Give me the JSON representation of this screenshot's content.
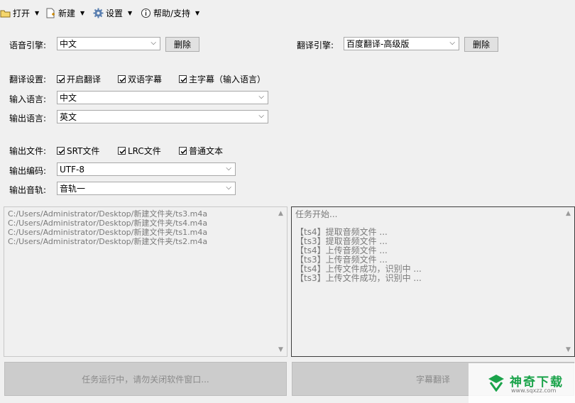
{
  "menu": {
    "open": "打开",
    "new": "新建",
    "settings": "设置",
    "help": "帮助/支持"
  },
  "speech_engine": {
    "label": "语音引擎:",
    "value": "中文",
    "delete": "删除"
  },
  "translate_engine": {
    "label": "翻译引擎:",
    "value": "百度翻译-高级版",
    "delete": "删除"
  },
  "translate_settings": {
    "label": "翻译设置:",
    "options": [
      {
        "label": "开启翻译",
        "checked": true
      },
      {
        "label": "双语字幕",
        "checked": true
      },
      {
        "label": "主字幕（输入语言）",
        "checked": true
      }
    ]
  },
  "input_language": {
    "label": "输入语言:",
    "value": "中文"
  },
  "output_language": {
    "label": "输出语言:",
    "value": "英文"
  },
  "output_files": {
    "label": "输出文件:",
    "options": [
      {
        "label": "SRT文件",
        "checked": true
      },
      {
        "label": "LRC文件",
        "checked": true
      },
      {
        "label": "普通文本",
        "checked": true
      }
    ]
  },
  "output_encoding": {
    "label": "输出编码:",
    "value": "UTF-8"
  },
  "output_track": {
    "label": "输出音轨:",
    "value": "音轨一"
  },
  "file_list": [
    "C:/Users/Administrator/Desktop/新建文件夹/ts3.m4a",
    "C:/Users/Administrator/Desktop/新建文件夹/ts4.m4a",
    "C:/Users/Administrator/Desktop/新建文件夹/ts1.m4a",
    "C:/Users/Administrator/Desktop/新建文件夹/ts2.m4a"
  ],
  "log": [
    "任务开始...",
    "",
    "【ts4】提取音频文件 ...",
    "【ts3】提取音频文件 ...",
    "【ts4】上传音频文件 ...",
    "【ts3】上传音频文件 ...",
    "【ts4】上传文件成功，识别中 ...",
    "【ts3】上传文件成功，识别中 ..."
  ],
  "buttons": {
    "running": "任务运行中，请勿关闭软件窗口...",
    "translate": "字幕翻译"
  },
  "watermark": {
    "name": "神奇下载",
    "url": "www.sqxzz.com"
  },
  "colors": {
    "accent_check": "#000000",
    "watermark_green": "#1aa34a"
  }
}
